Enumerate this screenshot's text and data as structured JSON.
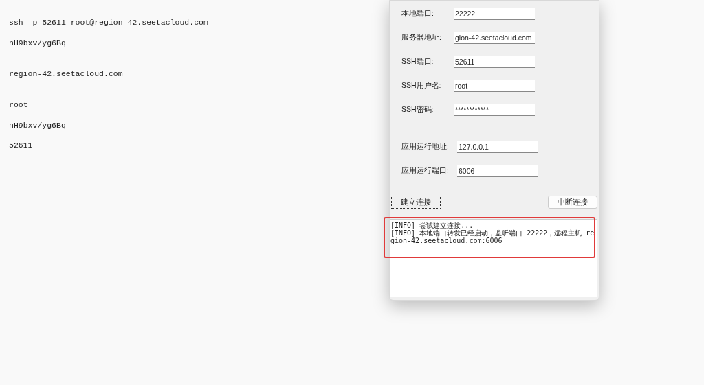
{
  "notes": [
    "ssh -p 52611 root@region-42.seetacloud.com",
    "nH9bxv/yg6Bq",
    "region-42.seetacloud.com",
    "root",
    "nH9bxv/yg6Bq",
    "52611"
  ],
  "form": {
    "ssh_fields": [
      {
        "label": "本地端口:",
        "value": "22222"
      },
      {
        "label": "服务器地址:",
        "value": "gion-42.seetacloud.com"
      },
      {
        "label": "SSH端口:",
        "value": "52611"
      },
      {
        "label": "SSH用户名:",
        "value": "root"
      },
      {
        "label": "SSH密码:",
        "value": "************"
      }
    ],
    "app_fields": [
      {
        "label": "应用运行地址:",
        "value": "127.0.0.1"
      },
      {
        "label": "应用运行端口:",
        "value": "6006"
      }
    ],
    "buttons": [
      {
        "label": "建立连接",
        "focused": true
      },
      {
        "label": "中断连接",
        "focused": false
      }
    ],
    "log": [
      "[INFO] 尝试建立连接...",
      "[INFO] 本地端口转发已经启动，监听端口 22222，远程主机 region-42.seetacloud.com:6006"
    ]
  }
}
